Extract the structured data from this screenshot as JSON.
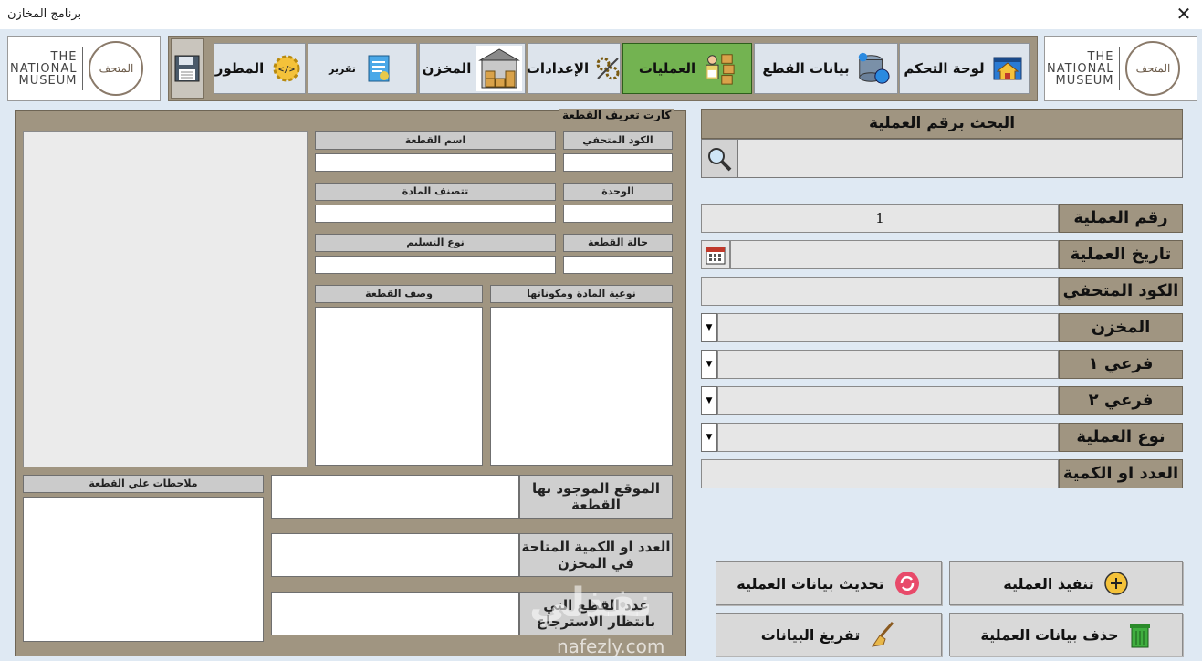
{
  "window": {
    "title": "برنامج المخازن",
    "close": "✕"
  },
  "logo": {
    "line1": "THE",
    "line2": "NATIONAL",
    "line3": "MUSEUM",
    "emblem": "المتحف"
  },
  "nav": [
    {
      "label": "لوحة التحكم",
      "icon": "house-icon",
      "glyph": "🏠"
    },
    {
      "label": "بيانات القطع",
      "icon": "database-icon",
      "glyph": "🗄"
    },
    {
      "label": "العمليات",
      "icon": "worker-boxes-icon",
      "glyph": "📦",
      "active": true
    },
    {
      "label": "الإعدادات",
      "icon": "gears-icon",
      "glyph": "⚙"
    },
    {
      "label": "المخزن",
      "icon": "warehouse-icon",
      "glyph": "🏬"
    },
    {
      "label": "تقرير",
      "icon": "report-icon",
      "glyph": "📋"
    },
    {
      "label": "المطور",
      "icon": "code-gear-icon",
      "glyph": "⚙"
    }
  ],
  "card": {
    "legend": "كارت تعريف القطعة",
    "fields": {
      "museum_code": "الكود المتحفي",
      "piece_name": "اسم القطعة",
      "unit": "الوحدة",
      "material_class": "تتصنف المادة",
      "piece_state": "حالة القطعة",
      "delivery_type": "نوع التسليم",
      "material_type": "نوعية المادة ومكوناتها",
      "piece_desc": "وصف القطعة",
      "notes": "ملاحظات علي القطعة"
    },
    "big": {
      "location": "الموقع الموجود بها القطعة",
      "available_qty": "العدد او الكمية المتاحة في المخزن",
      "pending_qty": "عدد القطع التي بانتظار الاسترجاع"
    }
  },
  "right": {
    "search_title": "البحث برقم العملية",
    "op_number_label": "رقم العملية",
    "op_number_value": "1",
    "op_date_label": "تاريخ العملية",
    "museum_code_label": "الكود المتحفي",
    "store_label": "المخزن",
    "sub1_label": "فرعي ١",
    "sub2_label": "فرعي ٢",
    "op_type_label": "نوع العملية",
    "qty_label": "العدد او الكمية"
  },
  "actions": {
    "execute": "تنفيذ العملية",
    "update": "تحديث بيانات العملية",
    "delete": "حذف بيانات العملية",
    "clear": "تفريغ البيانات"
  },
  "watermark": {
    "brand": "نفذلي",
    "site": "nafezly.com"
  },
  "colors": {
    "panel": "#a09581",
    "active_tab": "#73b351",
    "bg": "#dfe9f3"
  }
}
